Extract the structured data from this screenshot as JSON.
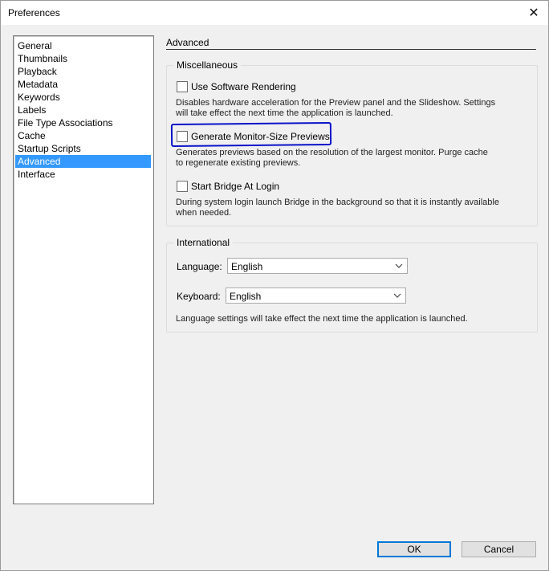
{
  "window": {
    "title": "Preferences",
    "close_glyph": "✕"
  },
  "sidebar": {
    "items": [
      {
        "label": "General"
      },
      {
        "label": "Thumbnails"
      },
      {
        "label": "Playback"
      },
      {
        "label": "Metadata"
      },
      {
        "label": "Keywords"
      },
      {
        "label": "Labels"
      },
      {
        "label": "File Type Associations"
      },
      {
        "label": "Cache"
      },
      {
        "label": "Startup Scripts"
      },
      {
        "label": "Advanced",
        "selected": true
      },
      {
        "label": "Interface"
      }
    ]
  },
  "panel": {
    "header": "Advanced",
    "misc": {
      "title": "Miscellaneous",
      "options": [
        {
          "label": "Use Software Rendering",
          "checked": false,
          "desc_line1": "Disables hardware acceleration for the Preview panel and the Slideshow. Settings",
          "desc_line2": "will take effect the next time the application is launched."
        },
        {
          "label": "Generate Monitor-Size Previews",
          "checked": false,
          "desc_line1": "Generates previews based on the resolution of the largest monitor.  Purge cache",
          "desc_line2": "to regenerate existing previews."
        },
        {
          "label": "Start Bridge At Login",
          "checked": false,
          "desc_line1": "During system login launch Bridge in the background so that it is instantly available",
          "desc_line2": "when needed."
        }
      ]
    },
    "international": {
      "title": "International",
      "language_label": "Language:",
      "language_value": "English",
      "keyboard_label": "Keyboard:",
      "keyboard_value": "English",
      "note": "Language settings will take effect the next time the application is launched."
    }
  },
  "buttons": {
    "ok": "OK",
    "cancel": "Cancel"
  },
  "colors": {
    "selection": "#3399ff",
    "highlight_annotation": "#0a13c8",
    "default_button_border": "#0078d7"
  }
}
